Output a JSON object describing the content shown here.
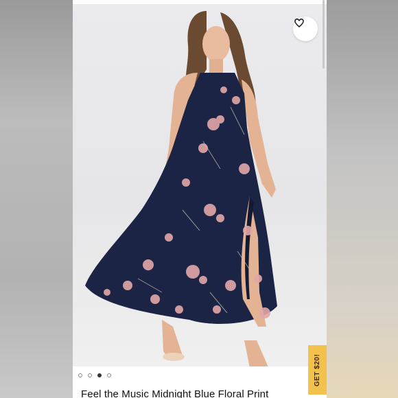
{
  "listing": {
    "title": "Feel the Music Midnight Blue Floral Print",
    "like_icon": "heart-outline-icon",
    "carousel": {
      "count": 4,
      "active_index": 2
    }
  },
  "promo": {
    "label": "GET $20!",
    "color": "#f3c24d"
  },
  "colors": {
    "dress": "#1c2446",
    "flower": "#e2a7a8"
  }
}
